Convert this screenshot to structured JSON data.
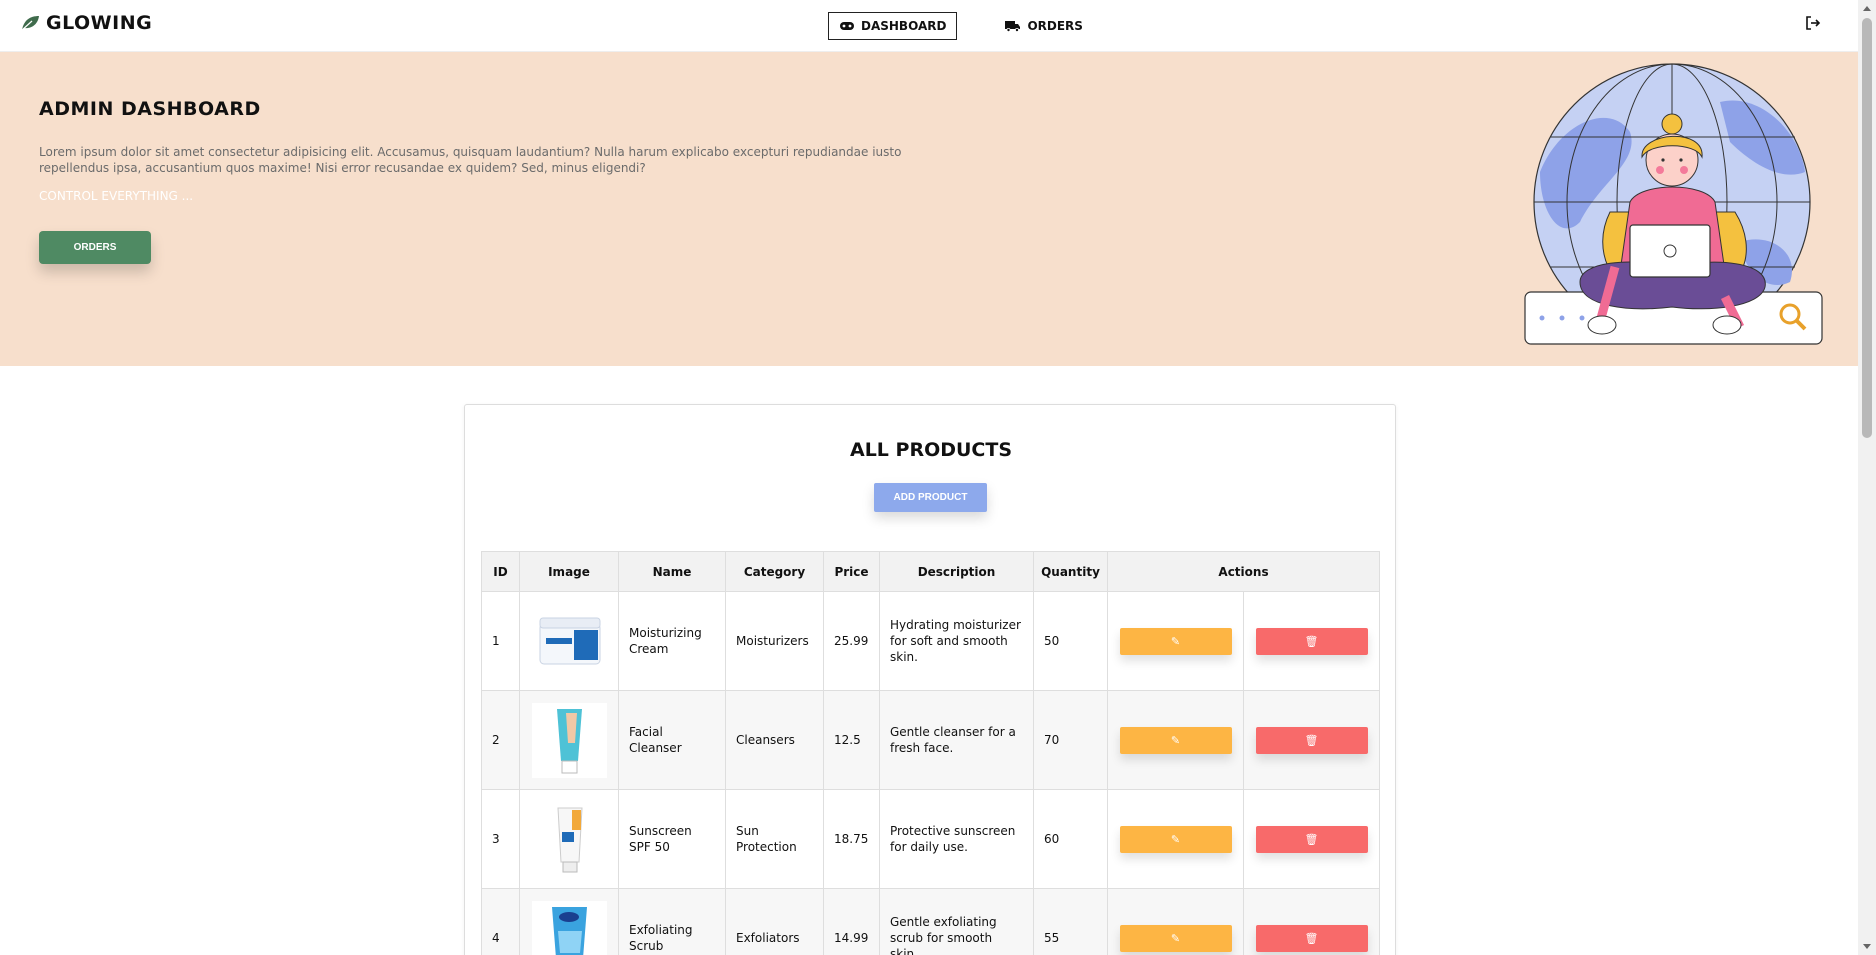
{
  "brand": {
    "name": "GLOWING",
    "icon": "leaf-icon"
  },
  "nav": {
    "links": [
      {
        "label": "DASHBOARD",
        "icon": "gamepad-icon",
        "active": true
      },
      {
        "label": "ORDERS",
        "icon": "truck-icon",
        "active": false
      }
    ],
    "logout_icon": "logout-icon"
  },
  "hero": {
    "title": "ADMIN DASHBOARD",
    "text": "Lorem ipsum dolor sit amet consectetur adipisicing elit. Accusamus, quisquam laudantium? Nulla harum explicabo excepturi repudiandae iusto repellendus ipsa, accusantium quos maxime! Nisi error recusandae ex quidem? Sed, minus eligendi?",
    "subtext": "CONTROL EVERYTHING ...",
    "button_label": "ORDERS",
    "background": "#f7dfcc"
  },
  "products": {
    "title": "ALL PRODUCTS",
    "add_label": "ADD PRODUCT",
    "columns": [
      "ID",
      "Image",
      "Name",
      "Category",
      "Price",
      "Description",
      "Quantity",
      "Actions"
    ],
    "rows": [
      {
        "id": "1",
        "name": "Moisturizing Cream",
        "category": "Moisturizers",
        "price": "25.99",
        "description": "Hydrating moisturizer for soft and smooth skin.",
        "quantity": "50"
      },
      {
        "id": "2",
        "name": "Facial Cleanser",
        "category": "Cleansers",
        "price": "12.5",
        "description": "Gentle cleanser for a fresh face.",
        "quantity": "70"
      },
      {
        "id": "3",
        "name": "Sunscreen SPF 50",
        "category": "Sun Protection",
        "price": "18.75",
        "description": "Protective sunscreen for daily use.",
        "quantity": "60"
      },
      {
        "id": "4",
        "name": "Exfoliating Scrub",
        "category": "Exfoliators",
        "price": "14.99",
        "description": "Gentle exfoliating scrub for smooth skin.",
        "quantity": "55"
      }
    ]
  },
  "colors": {
    "accent_green": "#4f8a63",
    "accent_blue": "#8da9ec",
    "edit": "#fdb544",
    "delete": "#f86a6a"
  }
}
